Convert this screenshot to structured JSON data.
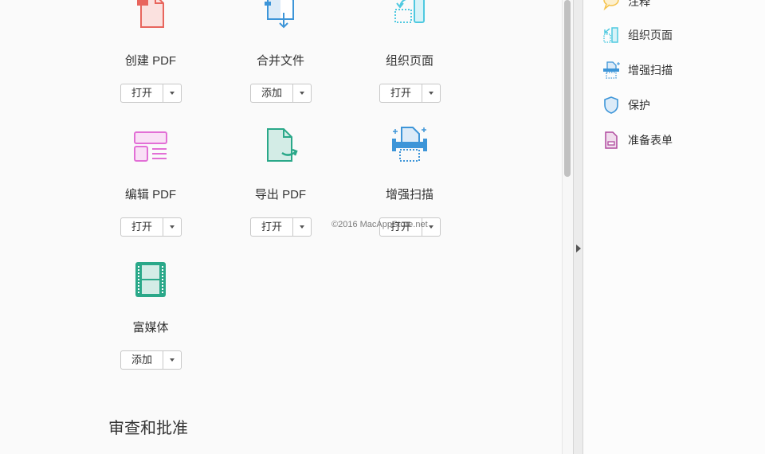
{
  "tools": [
    {
      "label": "创建 PDF",
      "button": "打开",
      "icon": "create-pdf-icon",
      "color": "#e8655d"
    },
    {
      "label": "合并文件",
      "button": "添加",
      "icon": "combine-files-icon",
      "color": "#3d95d8"
    },
    {
      "label": "组织页面",
      "button": "打开",
      "icon": "organize-pages-icon",
      "color": "#4fc9e0"
    },
    {
      "label": "编辑 PDF",
      "button": "打开",
      "icon": "edit-pdf-icon",
      "color": "#e26fd6"
    },
    {
      "label": "导出 PDF",
      "button": "打开",
      "icon": "export-pdf-icon",
      "color": "#2aa889"
    },
    {
      "label": "增强扫描",
      "button": "打开",
      "icon": "enhance-scan-icon",
      "color": "#3d95d8"
    },
    {
      "label": "富媒体",
      "button": "添加",
      "icon": "rich-media-icon",
      "color": "#2aa889"
    }
  ],
  "section_heading": "审查和批准",
  "watermark": "©2016 MacAppStore.net",
  "right_panel": {
    "items": [
      {
        "label": "注释",
        "icon": "comment-icon",
        "color": "#f5c24a"
      },
      {
        "label": "组织页面",
        "icon": "organize-pages-icon",
        "color": "#4fc9e0"
      },
      {
        "label": "增强扫描",
        "icon": "enhance-scan-icon",
        "color": "#3d95d8"
      },
      {
        "label": "保护",
        "icon": "shield-icon",
        "color": "#3d95d8"
      },
      {
        "label": "准备表单",
        "icon": "prepare-form-icon",
        "color": "#b04a9e"
      }
    ]
  }
}
